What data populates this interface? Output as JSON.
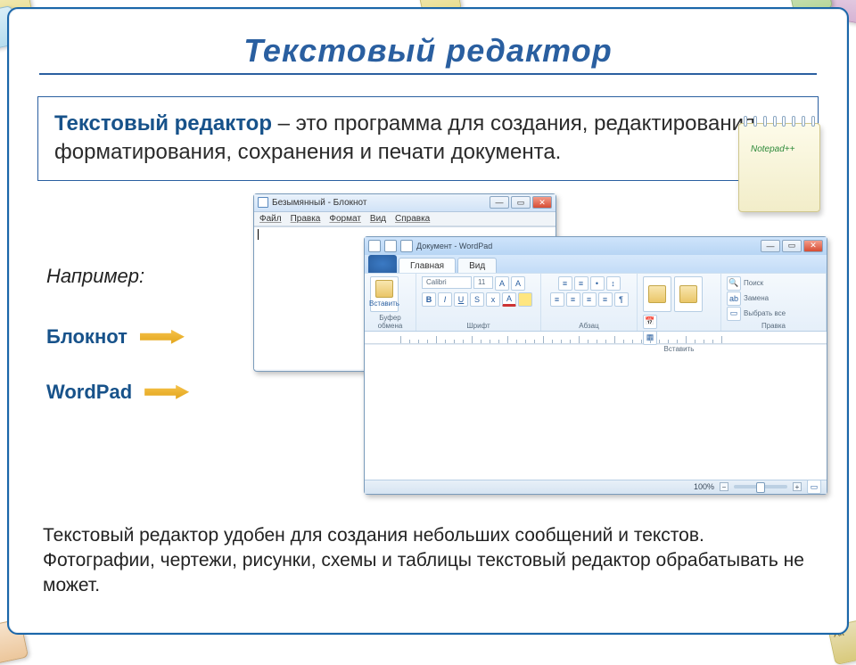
{
  "slide": {
    "title": "Текстовый редактор",
    "definition_term": "Текстовый редактор",
    "definition_rest": " – это программа для создания, редактирования, форматирования, сохранения и печати документа.",
    "example_label": "Например:",
    "app_notepad": "Блокнот",
    "app_wordpad": "WordPad",
    "bottom_text": "Текстовый редактор удобен для создания небольших сообщений и текстов. Фотографии, чертежи, рисунки, схемы и таблицы текстовый редактор обрабатывать не может."
  },
  "notepad": {
    "title": "Безымянный - Блокнот",
    "menu": {
      "file": "Файл",
      "edit": "Правка",
      "format": "Формат",
      "view": "Вид",
      "help": "Справка"
    }
  },
  "wordpad": {
    "qat_title": "Документ - WordPad",
    "tab_main": "Главная",
    "tab_view": "Вид",
    "group_clipboard": "Буфер обмена",
    "paste": "Вставить",
    "group_font": "Шрифт",
    "font_name": "Calibri",
    "font_size": "11",
    "group_para": "Абзац",
    "group_insert": "Вставить",
    "group_edit": "Правка",
    "find": "Поиск",
    "replace": "Замена",
    "select_all": "Выбрать все",
    "zoom": "100%"
  },
  "deco": {
    "notepad_logo": "Notepad++"
  }
}
